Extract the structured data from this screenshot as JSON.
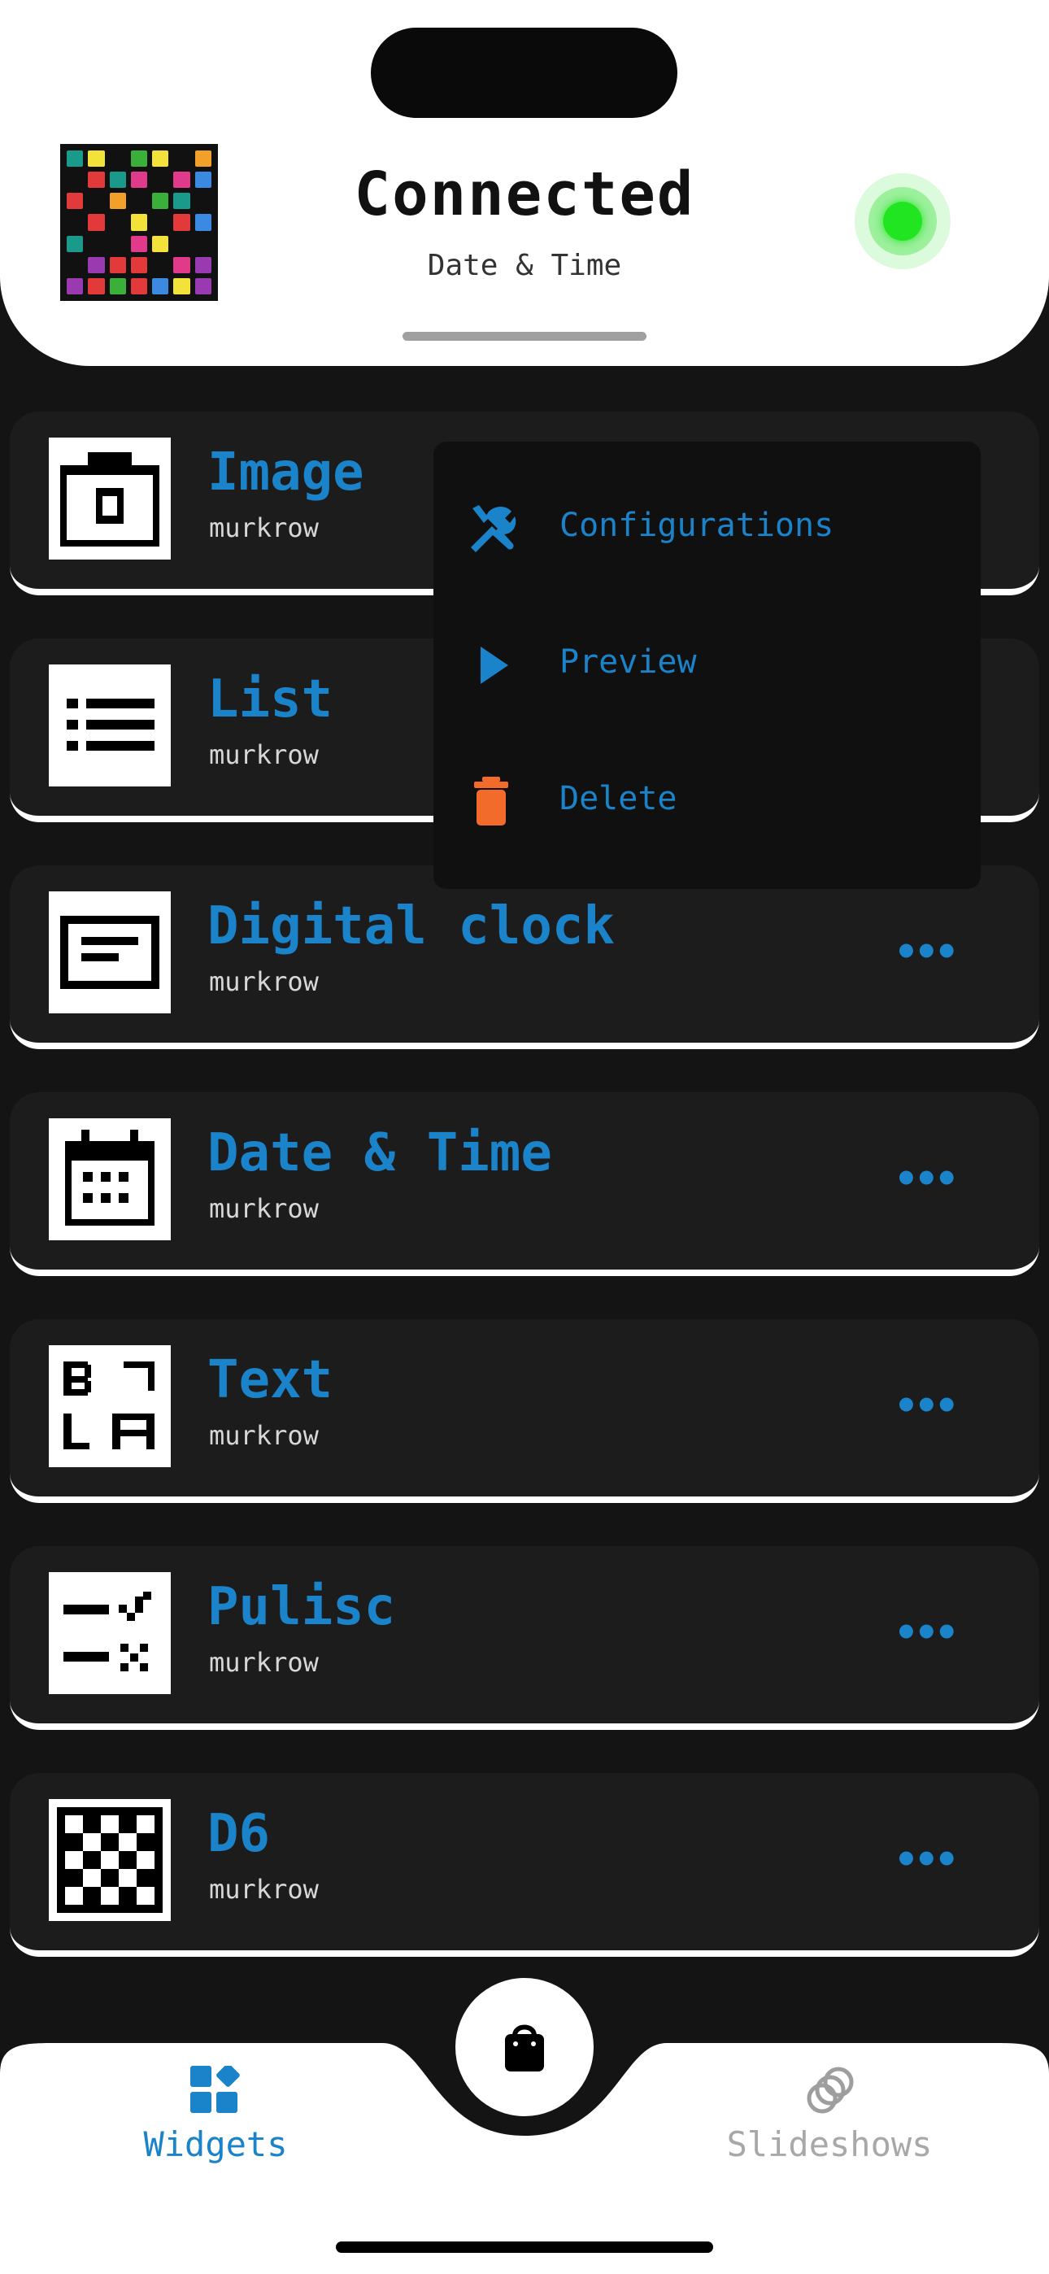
{
  "header": {
    "title": "Connected",
    "subtitle": "Date & Time",
    "status_color": "#22e522"
  },
  "widgets": [
    {
      "title": "Image",
      "author": "murkrow",
      "icon": "camera-icon"
    },
    {
      "title": "List",
      "author": "murkrow",
      "icon": "list-icon"
    },
    {
      "title": "Digital clock",
      "author": "murkrow",
      "icon": "display-icon",
      "more": "•••"
    },
    {
      "title": "Date & Time",
      "author": "murkrow",
      "icon": "calendar-icon",
      "more": "•••"
    },
    {
      "title": "Text",
      "author": "murkrow",
      "icon": "text-glyph-icon",
      "more": "•••"
    },
    {
      "title": "Pulisc",
      "author": "murkrow",
      "icon": "checklist-icon",
      "more": "•••"
    },
    {
      "title": "D6",
      "author": "murkrow",
      "icon": "checkerboard-icon",
      "more": "•••"
    }
  ],
  "context_menu": {
    "items": [
      {
        "label": "Configurations",
        "icon": "tools-icon"
      },
      {
        "label": "Preview",
        "icon": "play-icon"
      },
      {
        "label": "Delete",
        "icon": "trash-icon"
      }
    ]
  },
  "tabs": [
    {
      "label": "Widgets",
      "icon": "widgets-icon",
      "active": true
    },
    {
      "label": "Slideshows",
      "icon": "slideshows-icon",
      "active": false
    }
  ],
  "fab": {
    "icon": "shopping-bag-icon"
  },
  "colors": {
    "accent": "#1a83c9",
    "danger": "#f26b2a",
    "card_bg": "#1c1c1c",
    "page_bg": "#141414"
  }
}
